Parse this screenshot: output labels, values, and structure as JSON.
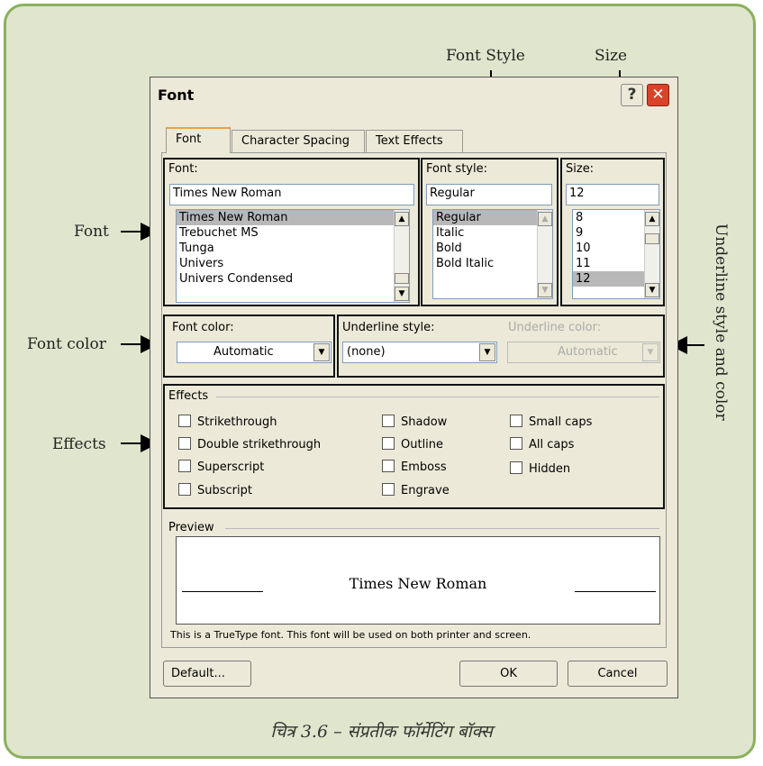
{
  "callouts": {
    "font_style": "Font Style",
    "size": "Size",
    "font": "Font",
    "font_color": "Font color",
    "effects": "Effects",
    "underline": "Underline style and color"
  },
  "caption": "चित्र 3.6 – संप्रतीक फॉर्मेटिंग बॉक्स",
  "dialog": {
    "title": "Font",
    "help_glyph": "?",
    "close_glyph": "✕",
    "tabs": [
      "Font",
      "Character Spacing",
      "Text Effects"
    ],
    "font_label": "Font:",
    "font_value": "Times New Roman",
    "font_list": [
      "Times New Roman",
      "Trebuchet MS",
      "Tunga",
      "Univers",
      "Univers Condensed"
    ],
    "style_label": "Font style:",
    "style_value": "Regular",
    "style_list": [
      "Regular",
      "Italic",
      "Bold",
      "Bold Italic"
    ],
    "size_label": "Size:",
    "size_value": "12",
    "size_list": [
      "8",
      "9",
      "10",
      "11",
      "12"
    ],
    "font_color_label": "Font color:",
    "font_color_value": "Automatic",
    "underline_style_label": "Underline style:",
    "underline_style_value": "(none)",
    "underline_color_label": "Underline color:",
    "underline_color_value": "Automatic",
    "effects_label": "Effects",
    "effects_col1": [
      "Strikethrough",
      "Double strikethrough",
      "Superscript",
      "Subscript"
    ],
    "effects_col2": [
      "Shadow",
      "Outline",
      "Emboss",
      "Engrave"
    ],
    "effects_col3": [
      "Small caps",
      "All caps",
      "Hidden"
    ],
    "preview_label": "Preview",
    "preview_text": "Times New Roman",
    "note": "This is a TrueType font. This font will be used on both printer and screen.",
    "default_button": "Default...",
    "ok_button": "OK",
    "cancel_button": "Cancel"
  }
}
